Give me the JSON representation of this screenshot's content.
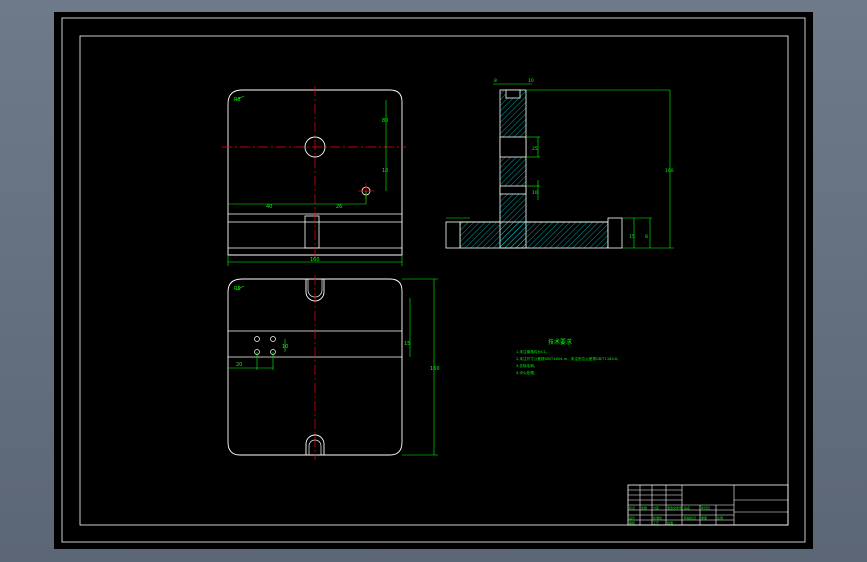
{
  "colors": {
    "background_outer": "#647083",
    "sheet": "#000000",
    "outline": "#ffffff",
    "dimension": "#00ff00",
    "centerline": "#ff0000",
    "hatch": "#00ffff"
  },
  "drawing": {
    "top_view": {
      "dims": {
        "d1": "R5",
        "d2": "80",
        "d3": "10",
        "d4": "40",
        "d5": "26",
        "d6": "160"
      }
    },
    "side_view": {
      "dims": {
        "d1": "8",
        "d2": "10",
        "d3": "25",
        "d4": "10",
        "d5": "160",
        "d6": "15",
        "d7": "8"
      }
    },
    "bottom_view": {
      "dims": {
        "d1": "R5",
        "d2": "15",
        "d3": "10",
        "d4": "20",
        "d5": "160"
      }
    },
    "notes": {
      "title": "技术要求",
      "lines": [
        "1.未注倒角均为C1。",
        "2.未注尺寸公差按GB/T1804-m，未注形位公差按GB/T1184-K。",
        "3.去除毛刺。",
        "4.淬火处理。"
      ]
    },
    "title_block": {
      "cells": [
        "标记",
        "处数",
        "分区",
        "更改文件号",
        "签名",
        "年月日",
        "设计",
        "标准化",
        "审核",
        "工艺",
        "批准",
        "阶段标记",
        "重量",
        "比例"
      ]
    }
  }
}
